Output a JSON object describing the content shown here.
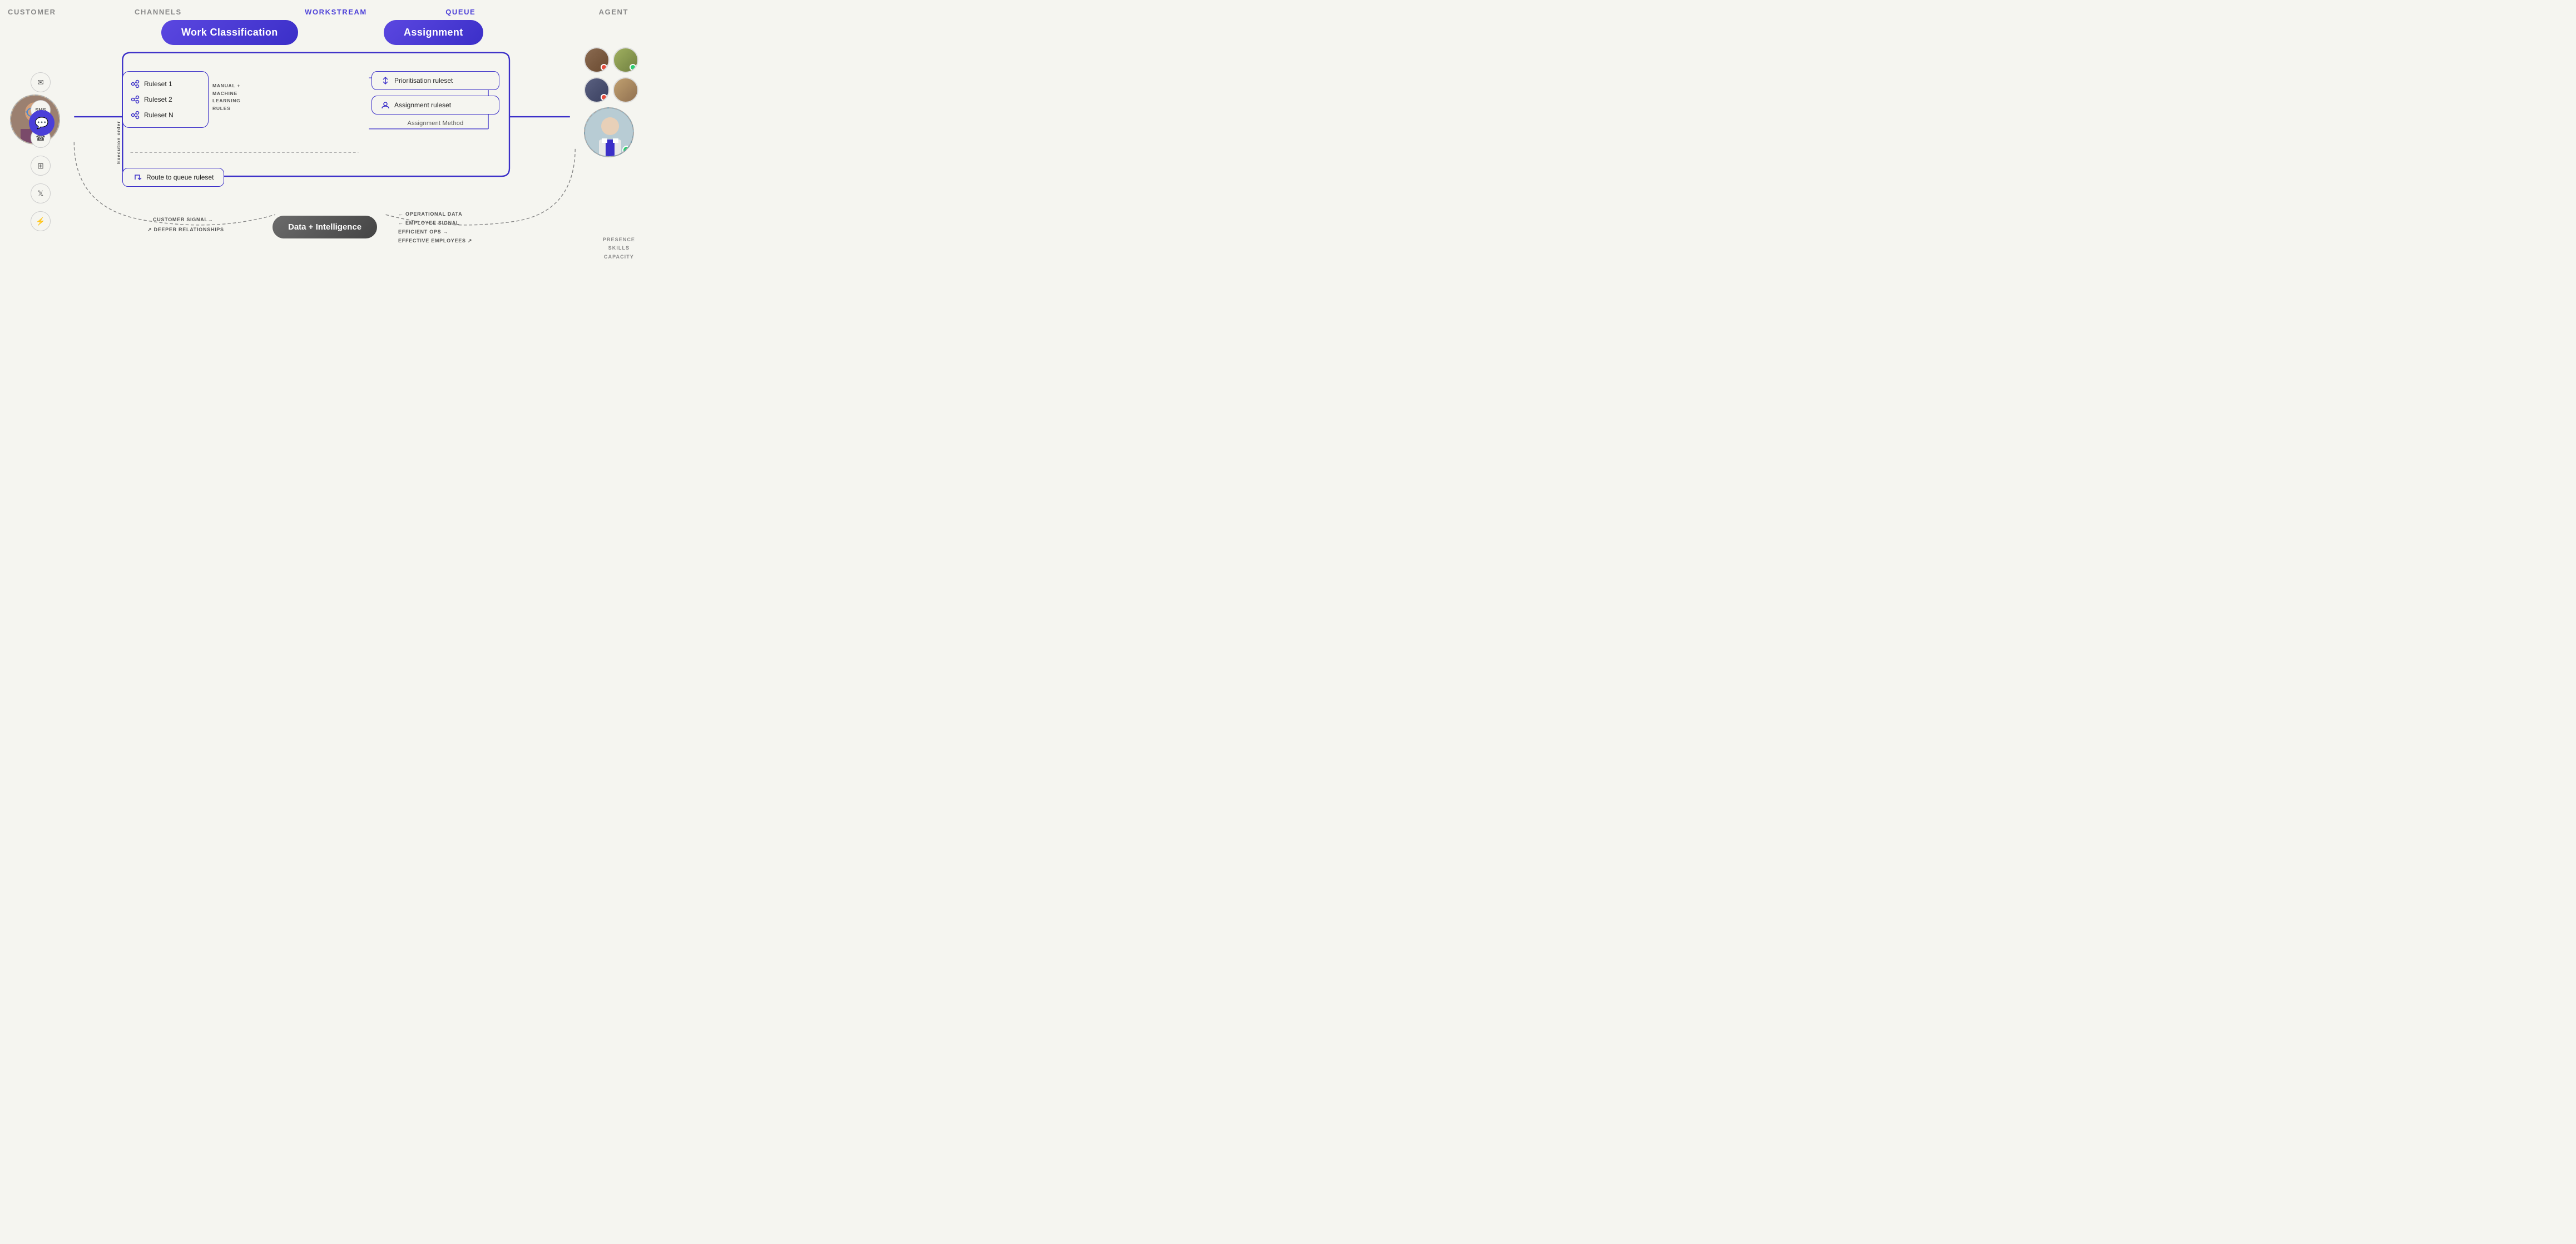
{
  "header": {
    "customer": "CUSTOMER",
    "channels": "CHANNELS",
    "workstream": "WORKSTREAM",
    "queue": "QUEUE",
    "agent": "AGENT"
  },
  "workstream": {
    "work_classification": "Work Classification",
    "assignment": "Assignment"
  },
  "rulesets": {
    "execution_order": "Execution order",
    "items": [
      {
        "label": "Ruleset 1"
      },
      {
        "label": "Ruleset 2"
      },
      {
        "label": "Ruleset N"
      }
    ],
    "ml_label": "MANUAL +\nMACHINE\nLEARNING\nRULES",
    "route_to_queue": "Route to queue ruleset"
  },
  "assignment": {
    "prioritisation": "Prioritisation ruleset",
    "assignment_ruleset": "Assignment ruleset",
    "method_label": "Assignment Method"
  },
  "data_intelligence": {
    "label": "Data + Intelligence",
    "left_labels": [
      "CUSTOMER SIGNAL→",
      "↗ DEEPER RELATIONSHIPS"
    ],
    "right_labels": [
      "← OPERATIONAL DATA",
      "← EMPLOYEE SIGNAL",
      "EFFICIENT OPS →",
      "EFFECTIVE EMPLOYEES ↗"
    ]
  },
  "agent": {
    "presence": "PRESENCE",
    "skills": "SKILLS",
    "capacity": "CAPACITY"
  }
}
